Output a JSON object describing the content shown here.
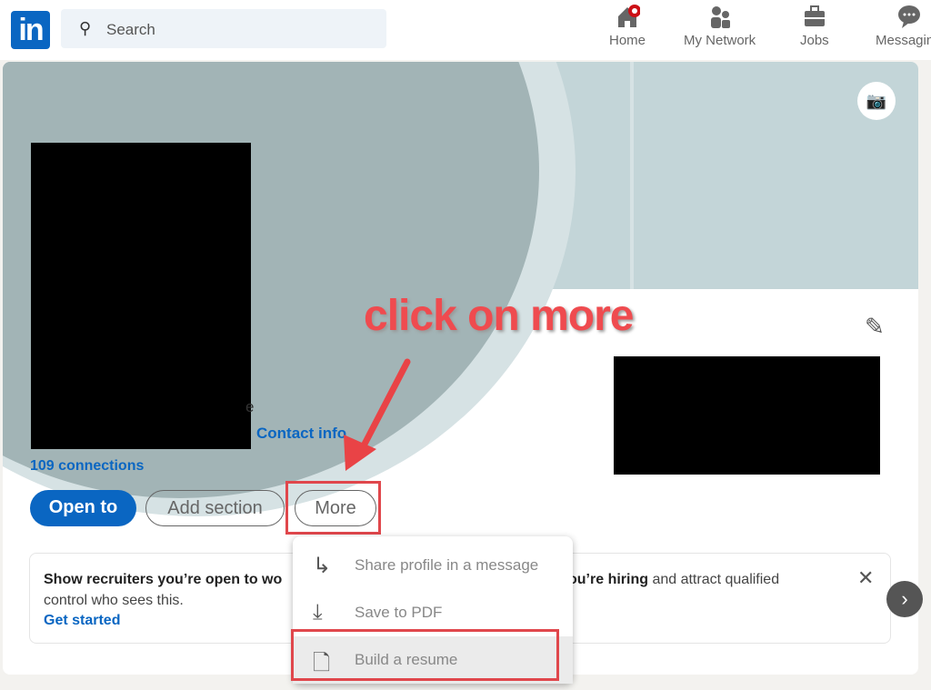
{
  "nav": {
    "logo": "in",
    "search_placeholder": "Search",
    "items": [
      {
        "label": "Home",
        "icon": "home-icon"
      },
      {
        "label": "My Network",
        "icon": "network-icon"
      },
      {
        "label": "Jobs",
        "icon": "briefcase-icon"
      },
      {
        "label": "Messagin",
        "icon": "chat-icon"
      }
    ]
  },
  "profile": {
    "contact_info": "Contact info",
    "connections": "109 connections",
    "partial_char": "e",
    "open_to": "Open to",
    "add_section": "Add section",
    "more": "More"
  },
  "annotation": "click on more",
  "promo": {
    "text_left": "Show recruiters you’re open to wo",
    "text_left2": "control who sees this.",
    "cta": "Get started",
    "text_right_bold": "ou’re hiring",
    "text_right": " and attract qualified"
  },
  "menu": {
    "items": [
      {
        "label": "Share profile in a message",
        "icon": "share-icon"
      },
      {
        "label": "Save to PDF",
        "icon": "download-icon"
      },
      {
        "label": "Build a resume",
        "icon": "document-icon"
      }
    ]
  },
  "colors": {
    "brand": "#0a66c2",
    "annotation": "#e0474c"
  }
}
